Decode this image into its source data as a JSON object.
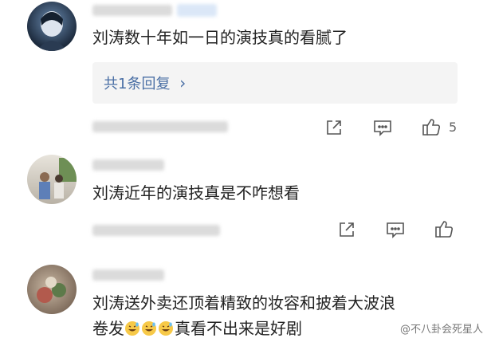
{
  "comments": [
    {
      "text": "刘涛数十年如一日的演技真的看腻了",
      "reply_count_label": "共1条回复",
      "reply_chevron": "›",
      "like_count": "5",
      "icons": [
        "share-icon",
        "comment-icon",
        "like-icon",
        "chevron-right-icon"
      ]
    },
    {
      "text": "刘涛近年的演技真是不咋想看",
      "icons": [
        "share-icon",
        "comment-icon",
        "like-icon"
      ]
    },
    {
      "text_line1": "刘涛送外卖还顶着精致的妆容和披着大波浪",
      "text_line2_pre": "卷发",
      "text_line2_emojis": [
        "grinning-sweat-emoji",
        "grinning-sweat-emoji",
        "grinning-sweat-emoji"
      ],
      "text_line2_post": "真看不出来是好剧"
    }
  ],
  "watermark": "@不八卦会死星人",
  "colors": {
    "link": "#4a6fa5",
    "icon": "#555555",
    "reply_bg": "#f4f4f4"
  }
}
